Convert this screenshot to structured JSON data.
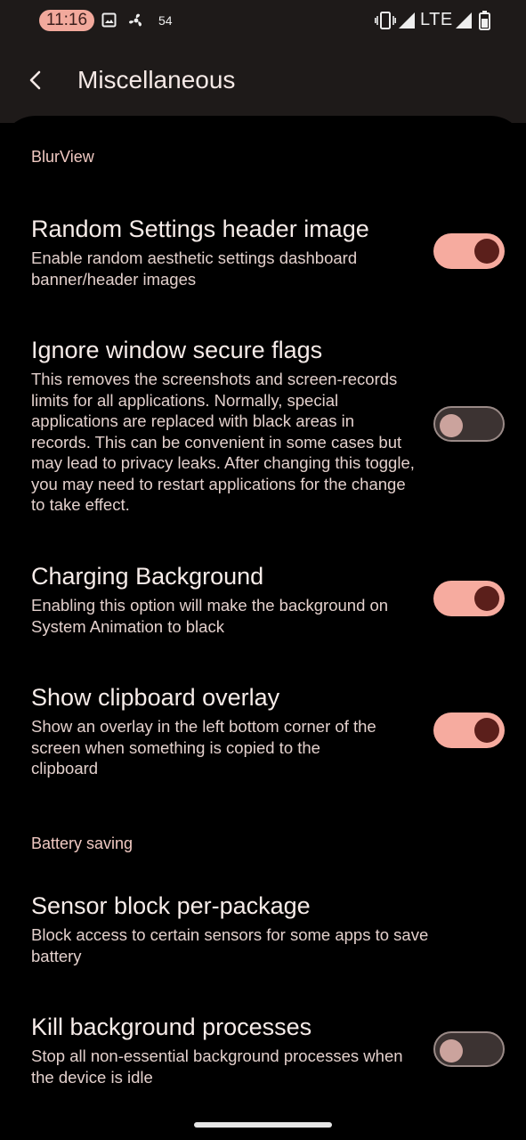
{
  "status_bar": {
    "time": "11:16",
    "notification_count": "54",
    "network": "LTE",
    "icons": [
      "image-icon",
      "fan-icon",
      "vibrate-icon",
      "signal-icon",
      "signal-icon",
      "battery-icon"
    ]
  },
  "header": {
    "back_icon": "chevron-left-icon",
    "title": "Miscellaneous"
  },
  "sections": [
    {
      "header": "BlurView",
      "items": [
        {
          "title": "Random Settings header image",
          "summary": "Enable random aesthetic settings dashboard banner/header images",
          "toggle": "on"
        },
        {
          "title": "Ignore window secure flags",
          "summary": "This removes the screenshots and screen-records limits for all applications. Normally, special applications are replaced with black areas in records. This can be convenient in some cases but may lead to privacy leaks. After changing this toggle, you may need to restart applications for the change to take effect.",
          "toggle": "off"
        },
        {
          "title": "Charging Background",
          "summary": "Enabling this option will make the background on System Animation to black",
          "toggle": "on"
        },
        {
          "title": "Show clipboard overlay",
          "summary": "Show an overlay in the left bottom corner of the screen when something is copied to the clipboard",
          "toggle": "on"
        }
      ]
    },
    {
      "header": "Battery saving",
      "items": [
        {
          "title": "Sensor block per-package",
          "summary": "Block access to certain sensors for some apps to save battery"
        },
        {
          "title": "Kill background processes",
          "summary": "Stop all non-essential background processes when the device is idle",
          "toggle": "off"
        }
      ]
    }
  ],
  "colors": {
    "accent": "#f6ab9f",
    "toggle_thumb_on": "#5b1f1b",
    "toggle_track_off": "#3c3332",
    "surface": "#1e1a19",
    "background": "#000000"
  }
}
